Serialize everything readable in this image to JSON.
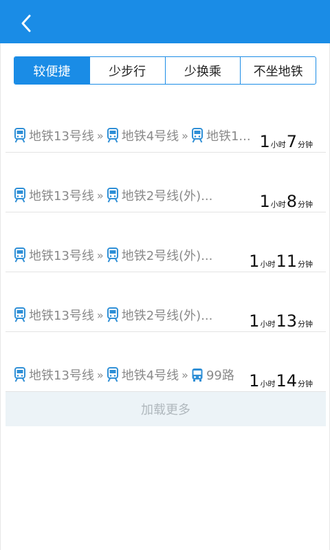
{
  "tabs": [
    {
      "label": "较便捷",
      "active": true
    },
    {
      "label": "少步行",
      "active": false
    },
    {
      "label": "少换乘",
      "active": false
    },
    {
      "label": "不坐地铁",
      "active": false
    }
  ],
  "routes": [
    {
      "segments": [
        {
          "type": "subway",
          "name": "地铁13号线"
        },
        {
          "type": "subway",
          "name": "地铁4号线"
        },
        {
          "type": "subway",
          "name": "地铁1..."
        }
      ],
      "hours": "1",
      "hour_unit": "小时",
      "minutes": "7",
      "minute_unit": "分钟"
    },
    {
      "segments": [
        {
          "type": "subway",
          "name": "地铁13号线"
        },
        {
          "type": "subway",
          "name": "地铁2号线(外)..."
        }
      ],
      "hours": "1",
      "hour_unit": "小时",
      "minutes": "8",
      "minute_unit": "分钟"
    },
    {
      "segments": [
        {
          "type": "subway",
          "name": "地铁13号线"
        },
        {
          "type": "subway",
          "name": "地铁2号线(外)..."
        }
      ],
      "hours": "1",
      "hour_unit": "小时",
      "minutes": "11",
      "minute_unit": "分钟"
    },
    {
      "segments": [
        {
          "type": "subway",
          "name": "地铁13号线"
        },
        {
          "type": "subway",
          "name": "地铁2号线(外)..."
        }
      ],
      "hours": "1",
      "hour_unit": "小时",
      "minutes": "13",
      "minute_unit": "分钟"
    },
    {
      "segments": [
        {
          "type": "subway",
          "name": "地铁13号线"
        },
        {
          "type": "subway",
          "name": "地铁4号线"
        },
        {
          "type": "bus",
          "name": "99路"
        }
      ],
      "hours": "1",
      "hour_unit": "小时",
      "minutes": "14",
      "minute_unit": "分钟"
    }
  ],
  "separator": "»",
  "load_more": "加载更多",
  "icons": {
    "back": "chevron-left-icon",
    "subway": "subway-icon",
    "bus": "bus-icon"
  },
  "colors": {
    "accent": "#1a8ce6",
    "text_secondary": "#8a8a8a",
    "load_more_bg": "#ecf3f7"
  }
}
